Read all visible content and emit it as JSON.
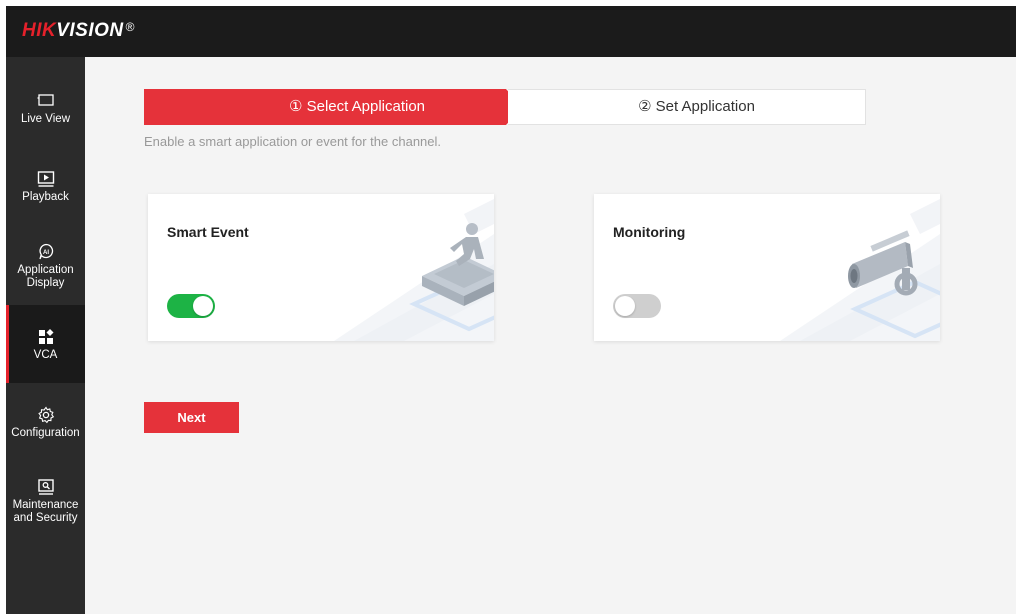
{
  "header": {
    "logo_hik": "HIK",
    "logo_vision": "VISION",
    "logo_reg": "®"
  },
  "sidebar": {
    "items": [
      {
        "label_lines": [
          "Live View"
        ],
        "icon": "monitor-icon",
        "active": false
      },
      {
        "label_lines": [
          "Playback"
        ],
        "icon": "playback-icon",
        "active": false
      },
      {
        "label_lines": [
          "Application",
          "Display"
        ],
        "icon": "ai-icon",
        "active": false
      },
      {
        "label_lines": [
          "VCA"
        ],
        "icon": "vca-grid-icon",
        "active": true
      },
      {
        "label_lines": [
          "Configuration"
        ],
        "icon": "gear-icon",
        "active": false
      },
      {
        "label_lines": [
          "Maintenance",
          "and Security"
        ],
        "icon": "maintenance-icon",
        "active": false
      }
    ]
  },
  "steps": {
    "step1": "① Select Application",
    "step2": "② Set Application",
    "active_step": 1
  },
  "main": {
    "hint": "Enable a smart application or event for the channel.",
    "cards": [
      {
        "title": "Smart Event",
        "enabled": true
      },
      {
        "title": "Monitoring",
        "enabled": false
      }
    ],
    "next_label": "Next"
  },
  "colors": {
    "accent": "#e5323a",
    "toggle_on": "#1db345",
    "toggle_off": "#cfcfcf",
    "sidebar_bg": "#2b2b2b",
    "header_bg": "#1b1b1b"
  }
}
